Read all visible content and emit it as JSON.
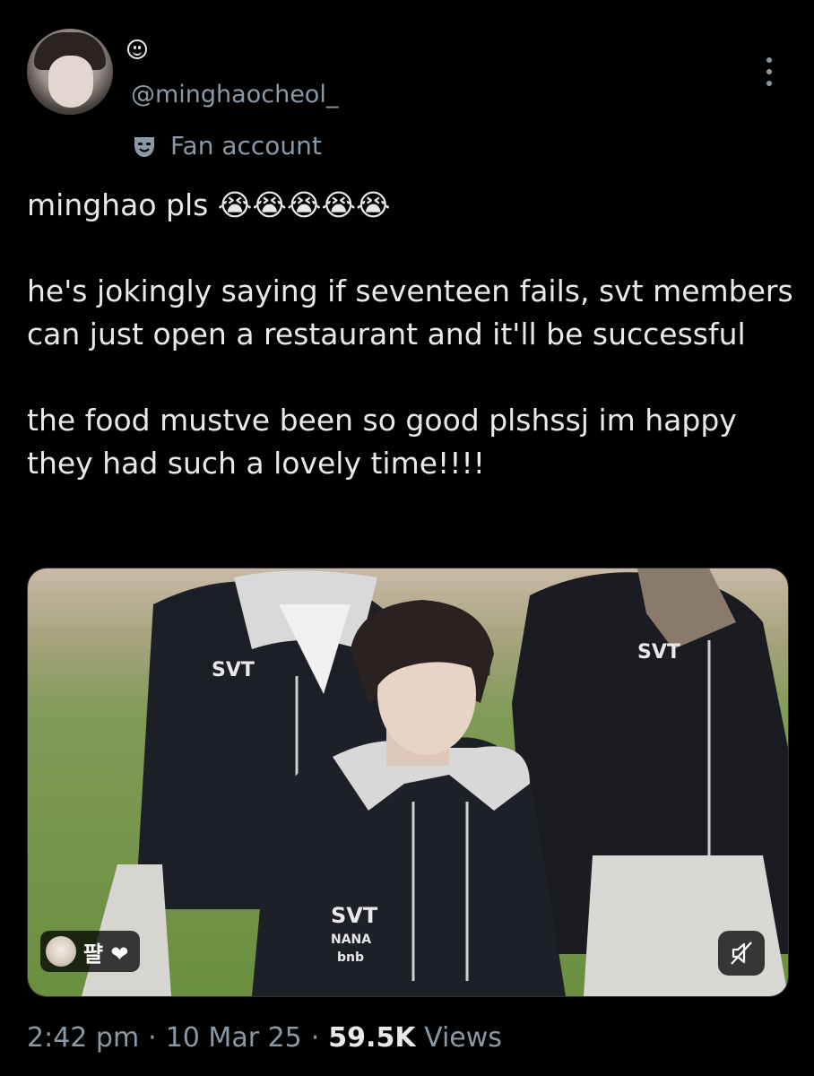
{
  "tweet": {
    "handle": "@minghaocheol_",
    "label": "Fan account",
    "text": "minghao pls 😭😭😭😭😭\n\nhe's jokingly saying if seventeen fails, svt members can just open a restaurant and it'll be successful\n\nthe food mustve been so good plshssj im happy they had such a lovely time!!!!",
    "media": {
      "badge_text": "퍌 ❤",
      "hoodie_logo": [
        "SVT",
        "NANA",
        "bnb"
      ],
      "mute_icon": "speaker-muted-icon"
    },
    "meta": {
      "time": "2:42 pm",
      "dot": "·",
      "date": "10 Mar 25",
      "views_count": "59.5K",
      "views_label": "Views"
    }
  },
  "icons": {
    "status": "smiley-icon",
    "label": "theater-mask-icon",
    "menu": "more-vertical-icon"
  },
  "colors": {
    "background": "#000000",
    "text": "#e7e9ea",
    "secondary": "#8b98a5"
  }
}
